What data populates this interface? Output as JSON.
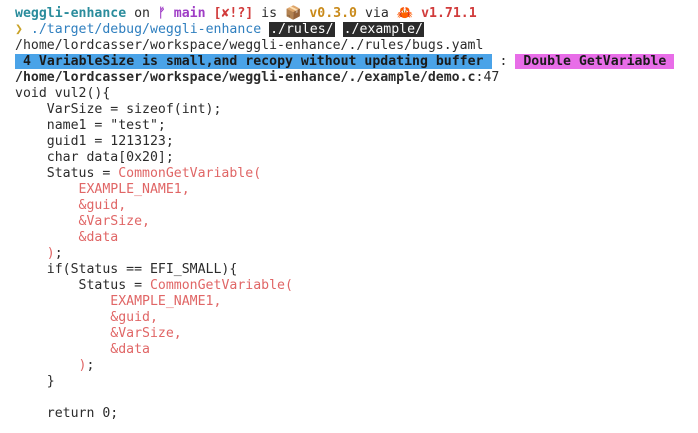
{
  "prompt_line": {
    "dir": "weggli-enhance",
    "on": " on ",
    "branch_glyph": "ᚠ",
    "branch": "main",
    "status": "[✘!?]",
    "is": " is ",
    "pkg_glyph": "📦",
    "version": "v0.3.0",
    "via": " via ",
    "rust_glyph": "🦀",
    "rust_version": "v1.71.1"
  },
  "command_line": {
    "prompt_char": "❯",
    "command": "./target/debug/weggli-enhance",
    "arg1": "./rules/",
    "arg2": "./example/"
  },
  "rules_path": "/home/lordcasser/workspace/weggli-enhance/./rules/bugs.yaml",
  "finding": {
    "message": "4 VariableSize is small,and recopy without updating buffer",
    "separator": ":",
    "tag": "Double GetVariable"
  },
  "source": {
    "path": "/home/lordcasser/workspace/weggli-enhance/./example/demo.c",
    "line": ":47"
  },
  "code": {
    "l1": "void vul2(){",
    "l2": "    VarSize = sizeof(int);",
    "l3": "    name1 = \"test\";",
    "l4": "    guid1 = 1213123;",
    "l5": "    char data[0x20];",
    "l6_pre": "    Status = ",
    "l6_hl": "CommonGetVariable(",
    "l7": "        EXAMPLE_NAME1,",
    "l8": "        &guid,",
    "l9": "        &VarSize,",
    "l10": "        &data",
    "l11_pre": "    ",
    "l11_hl": ")",
    "l11_post": ";",
    "l12": "    if(Status == EFI_SMALL){",
    "l13_pre": "        Status = ",
    "l13_hl": "CommonGetVariable(",
    "l14": "            EXAMPLE_NAME1,",
    "l15": "            &guid,",
    "l16": "            &VarSize,",
    "l17": "            &data",
    "l18_pre": "        ",
    "l18_hl": ")",
    "l18_post": ";",
    "l19": "    }",
    "l20": "",
    "l21": "    return 0;"
  }
}
